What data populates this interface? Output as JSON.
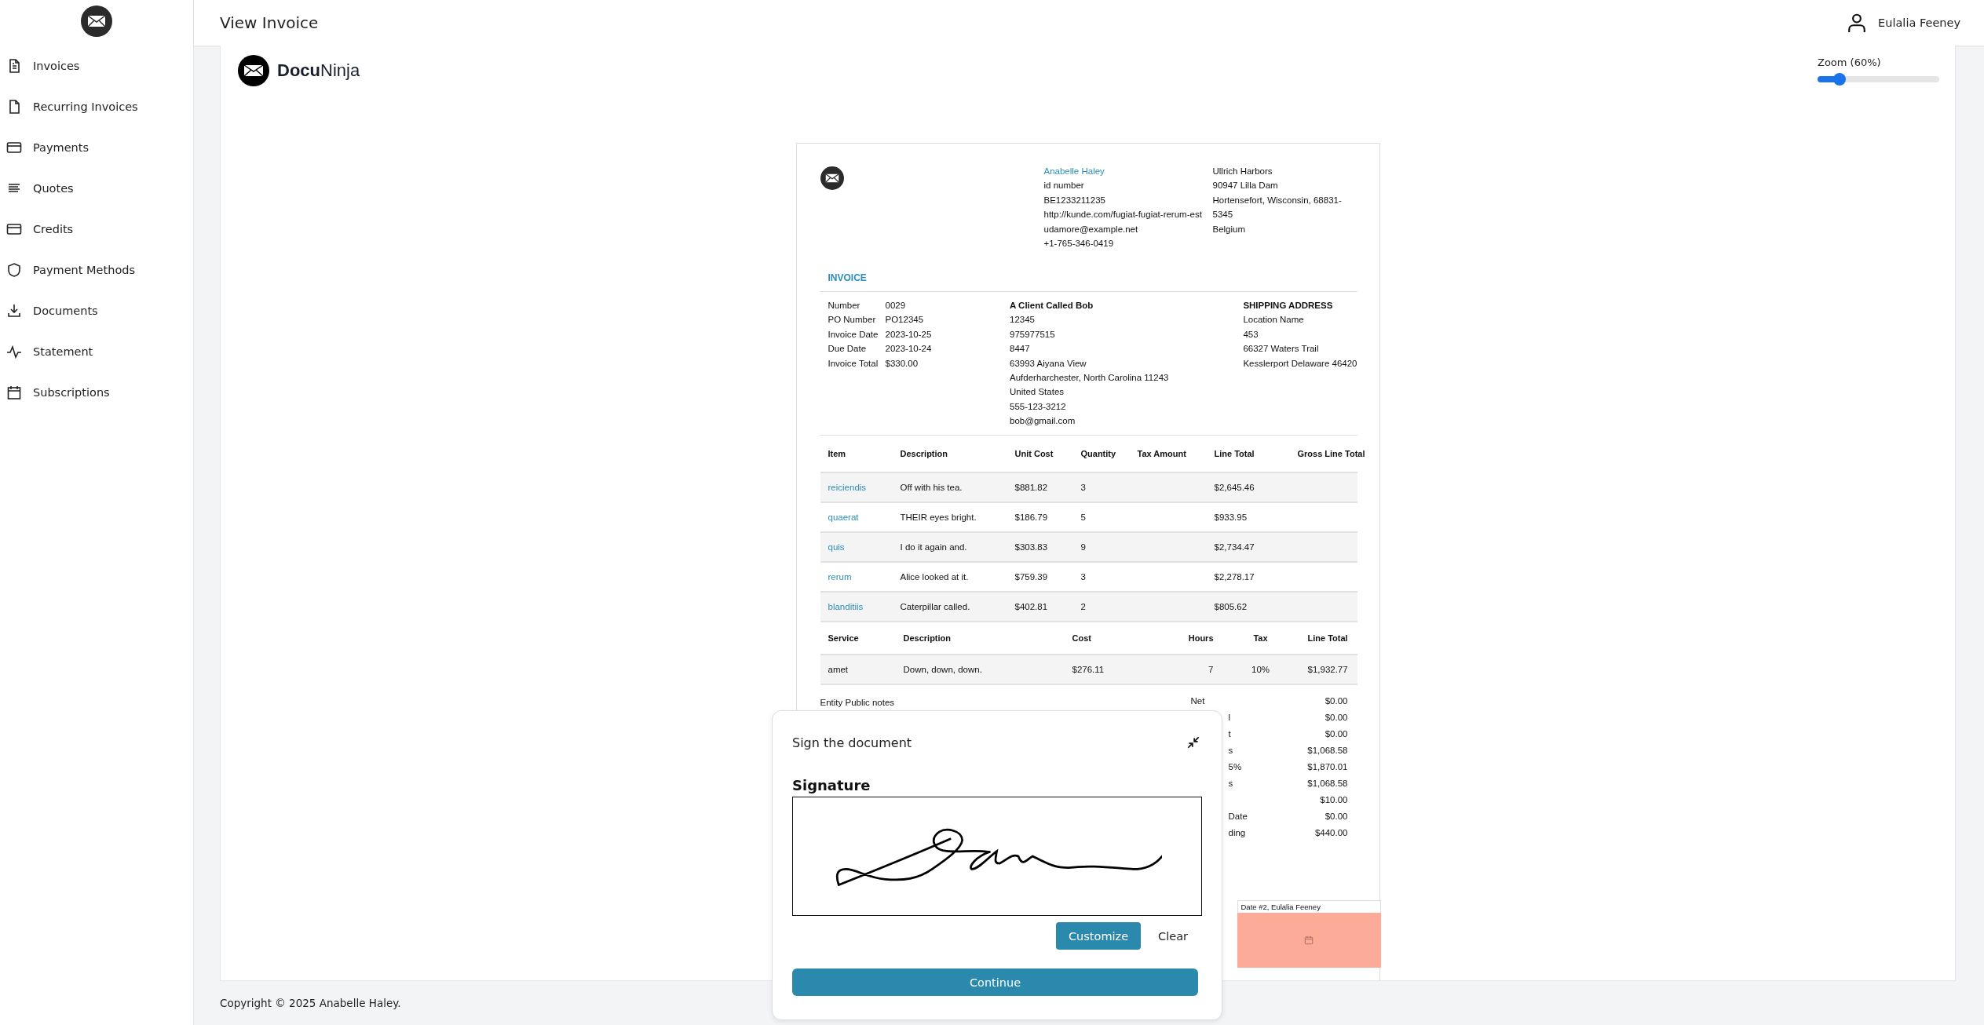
{
  "sidebar": {
    "items": [
      {
        "label": "Invoices",
        "selected": false
      },
      {
        "label": "Recurring Invoices",
        "selected": false
      },
      {
        "label": "Payments",
        "selected": false
      },
      {
        "label": "Quotes",
        "selected": false
      },
      {
        "label": "Credits",
        "selected": false
      },
      {
        "label": "Payment Methods",
        "selected": false
      },
      {
        "label": "Documents",
        "selected": false
      },
      {
        "label": "Statement",
        "selected": false
      },
      {
        "label": "Subscriptions",
        "selected": false
      }
    ]
  },
  "header": {
    "title": "View Invoice",
    "user": "Eulalia Feeney"
  },
  "brand": "**Docu**Ninja",
  "zoom": {
    "label": "Zoom (60%)",
    "level": 0.18
  },
  "invoice": {
    "company": [
      "Anabelle Haley",
      "id number",
      "BE1233211235",
      "http://kunde.com/fugiat-fugiat-rerum-est",
      "udamore@example.net",
      "+1-765-346-0419"
    ],
    "address": [
      "Ullrich Harbors",
      "90947 Lilla Dam",
      "Hortensefort, Wisconsin, 68831-5345",
      "Belgium"
    ],
    "heading": "INVOICE",
    "details": [
      {
        "label": "Number",
        "value": "0029"
      },
      {
        "label": "PO Number",
        "value": "PO12345"
      },
      {
        "label": "Invoice Date",
        "value": "2023-10-25"
      },
      {
        "label": "Due Date",
        "value": "2023-10-24"
      },
      {
        "label": "Invoice Total",
        "value": "$330.00"
      }
    ],
    "client": {
      "name": "A Client Called Bob",
      "lines": [
        "12345",
        "975977515",
        "8447",
        "63993 Aiyana View",
        "Aufderharchester, North Carolina 11243",
        "United States",
        "555-123-3212",
        "bob@gmail.com"
      ]
    },
    "shipping": {
      "title": "SHIPPING ADDRESS",
      "lines": [
        "Location Name",
        "453",
        "66327 Waters Trail",
        "Kesslerport Delaware 46420"
      ]
    },
    "products": {
      "columns": [
        "Item",
        "Description",
        "Unit Cost",
        "Quantity",
        "Tax Amount",
        "Line Total",
        "Gross Line Total"
      ],
      "rows": [
        [
          "reiciendis",
          "Off with his tea.",
          "$881.82",
          "3",
          "",
          "$2,645.46",
          ""
        ],
        [
          "quaerat",
          "THEIR eyes bright.",
          "$186.79",
          "5",
          "",
          "$933.95",
          ""
        ],
        [
          "quis",
          "I do it again and.",
          "$303.83",
          "9",
          "",
          "$2,734.47",
          ""
        ],
        [
          "rerum",
          "Alice looked at it.",
          "$759.39",
          "3",
          "",
          "$2,278.17",
          ""
        ],
        [
          "blanditiis",
          "Caterpillar called.",
          "$402.81",
          "2",
          "",
          "$805.62",
          ""
        ]
      ]
    },
    "services": {
      "columns": [
        "Service",
        "Description",
        "Cost",
        "Hours",
        "Tax",
        "Line Total"
      ],
      "rows": [
        [
          "amet",
          "Down, down, down.",
          "$276.11",
          "7",
          "10%",
          "$1,932.77"
        ]
      ]
    },
    "notes": "Entity Public notes",
    "totals": [
      {
        "label": "Net",
        "value": "$0.00"
      },
      {
        "label": "l",
        "value": "$0.00"
      },
      {
        "label": "t",
        "value": "$0.00"
      },
      {
        "label": "s",
        "value": "$1,068.58"
      },
      {
        "label": "5%",
        "value": "$1,870.01"
      },
      {
        "label": "s",
        "value": "$1,068.58"
      },
      {
        "value": "$10.00"
      },
      {
        "label": "Date",
        "value": "$0.00"
      },
      {
        "label": "ding",
        "value": "$440.00"
      }
    ],
    "date_field": {
      "label": "Date #2, Eulalia Feeney"
    }
  },
  "dialog": {
    "title": "Sign the document",
    "signature_label": "Signature",
    "customize": "Customize",
    "clear": "Clear",
    "continue": "Continue"
  },
  "footer": "Copyright © 2025 Anabelle Haley."
}
